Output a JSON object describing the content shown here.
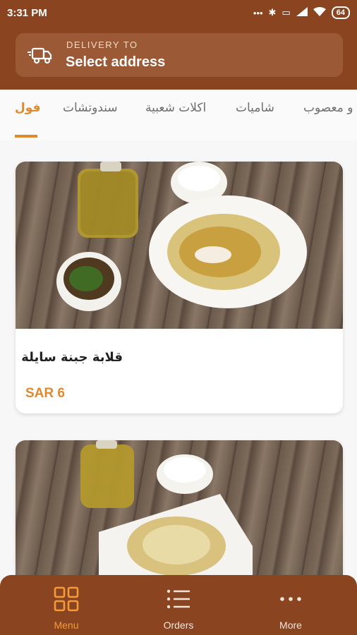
{
  "status_bar": {
    "time": "3:31 PM",
    "icons": [
      "dots-icon",
      "bluetooth-icon",
      "vibrate-icon",
      "signal-icon",
      "wifi-icon",
      "battery-icon"
    ],
    "battery_level": "64"
  },
  "header": {
    "delivery_label": "DELIVERY TO",
    "address": "Select address"
  },
  "tabs": [
    {
      "label": "فول",
      "active": true
    },
    {
      "label": "سندوتشات",
      "active": false
    },
    {
      "label": "اكلات شعبية",
      "active": false
    },
    {
      "label": "شاميات",
      "active": false
    },
    {
      "label": "و معصوب",
      "active": false
    }
  ],
  "menu_items": [
    {
      "name": "قلابة جبنة سايلة",
      "price": "SAR 6"
    },
    {
      "name": "",
      "price": ""
    }
  ],
  "bottom_nav": [
    {
      "label": "Menu",
      "icon": "grid-icon",
      "active": true
    },
    {
      "label": "Orders",
      "icon": "list-icon",
      "active": false
    },
    {
      "label": "More",
      "icon": "more-dots-icon",
      "active": false
    }
  ],
  "colors": {
    "brand": "#8a4420",
    "accent": "#e08a2e"
  }
}
